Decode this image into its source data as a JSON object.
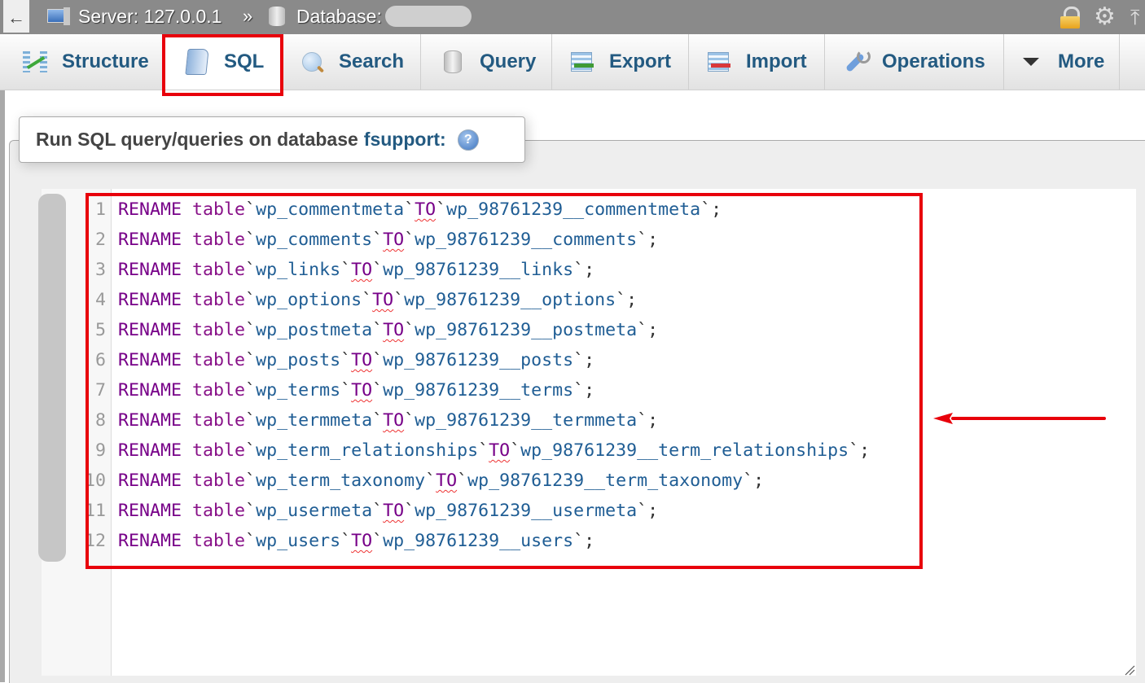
{
  "topbar": {
    "back_label": "←",
    "server_label": "Server: 127.0.0.1",
    "separator": "»",
    "database_label": "Database:",
    "icons": [
      "server-icon",
      "database-icon",
      "lock-icon",
      "gear-icon",
      "collapse-icon"
    ]
  },
  "tabs": [
    {
      "label": "Structure",
      "icon": "structure-icon",
      "active": false
    },
    {
      "label": "SQL",
      "icon": "sql-scroll-icon",
      "active": true
    },
    {
      "label": "Search",
      "icon": "search-icon",
      "active": false
    },
    {
      "label": "Query",
      "icon": "query-icon",
      "active": false
    },
    {
      "label": "Export",
      "icon": "export-icon",
      "active": false
    },
    {
      "label": "Import",
      "icon": "import-icon",
      "active": false
    },
    {
      "label": "Operations",
      "icon": "wrench-icon",
      "active": false
    },
    {
      "label": "More",
      "icon": "dropdown-triangle-icon",
      "active": false
    }
  ],
  "panel": {
    "title_prefix": "Run SQL query/queries on database",
    "database_name": "fsupport:",
    "help_icon": "?"
  },
  "editor": {
    "lines": [
      {
        "num": "1",
        "kw": "RENAME",
        "tbl": "table",
        "src": "wp_commentmeta",
        "to": "TO",
        "dst": "wp_98761239__commentmeta"
      },
      {
        "num": "2",
        "kw": "RENAME",
        "tbl": "table",
        "src": "wp_comments",
        "to": "TO",
        "dst": "wp_98761239__comments"
      },
      {
        "num": "3",
        "kw": "RENAME",
        "tbl": "table",
        "src": "wp_links",
        "to": "TO",
        "dst": "wp_98761239__links"
      },
      {
        "num": "4",
        "kw": "RENAME",
        "tbl": "table",
        "src": "wp_options",
        "to": "TO",
        "dst": "wp_98761239__options"
      },
      {
        "num": "5",
        "kw": "RENAME",
        "tbl": "table",
        "src": "wp_postmeta",
        "to": "TO",
        "dst": "wp_98761239__postmeta"
      },
      {
        "num": "6",
        "kw": "RENAME",
        "tbl": "table",
        "src": "wp_posts",
        "to": "TO",
        "dst": "wp_98761239__posts"
      },
      {
        "num": "7",
        "kw": "RENAME",
        "tbl": "table",
        "src": "wp_terms",
        "to": "TO",
        "dst": "wp_98761239__terms"
      },
      {
        "num": "8",
        "kw": "RENAME",
        "tbl": "table",
        "src": "wp_termmeta",
        "to": "TO",
        "dst": "wp_98761239__termmeta"
      },
      {
        "num": "9",
        "kw": "RENAME",
        "tbl": "table",
        "src": "wp_term_relationships",
        "to": "TO",
        "dst": "wp_98761239__term_relationships"
      },
      {
        "num": "10",
        "kw": "RENAME",
        "tbl": "table",
        "src": "wp_term_taxonomy",
        "to": "TO",
        "dst": "wp_98761239__term_taxonomy"
      },
      {
        "num": "11",
        "kw": "RENAME",
        "tbl": "table",
        "src": "wp_usermeta",
        "to": "TO",
        "dst": "wp_98761239__usermeta"
      },
      {
        "num": "12",
        "kw": "RENAME",
        "tbl": "table",
        "src": "wp_users",
        "to": "TO",
        "dst": "wp_98761239__users"
      }
    ],
    "backtick": "`",
    "terminator": ";"
  },
  "annotations": {
    "highlight_color": "#e8000b",
    "arrow_direction": "left"
  }
}
